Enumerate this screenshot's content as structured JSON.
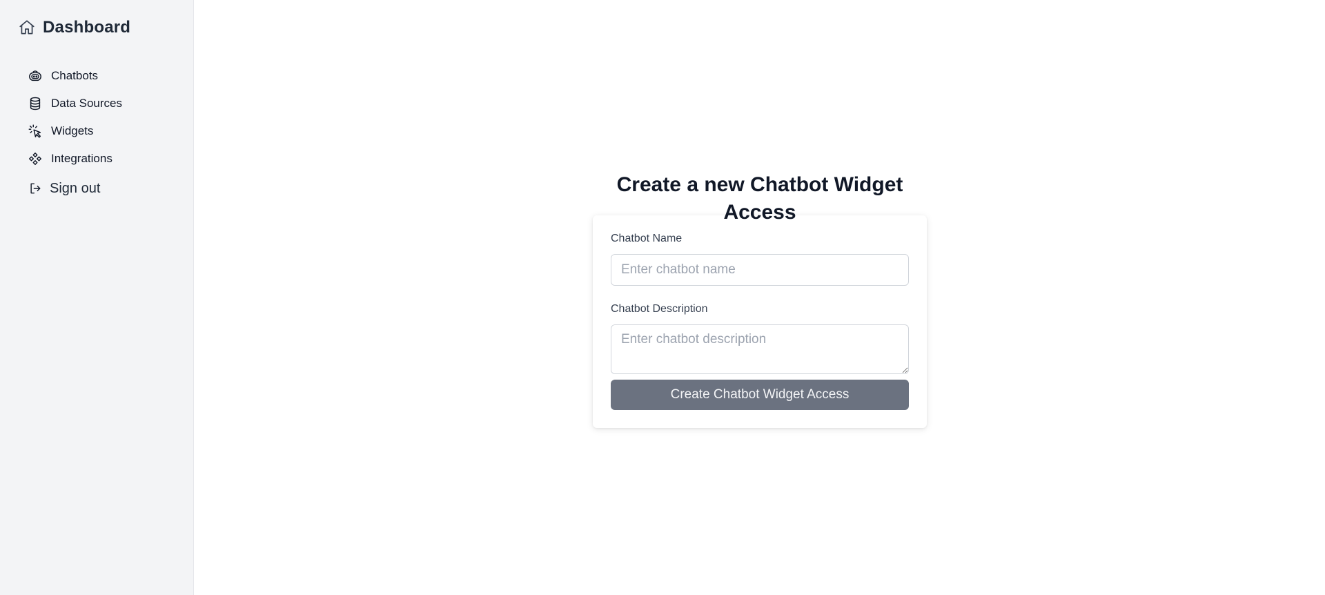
{
  "sidebar": {
    "brand": {
      "label": "Dashboard",
      "icon": "home-icon"
    },
    "items": [
      {
        "label": "Chatbots",
        "icon": "robot-icon"
      },
      {
        "label": "Data Sources",
        "icon": "database-icon"
      },
      {
        "label": "Widgets",
        "icon": "cursor-click-icon"
      },
      {
        "label": "Integrations",
        "icon": "integrations-icon"
      }
    ],
    "signout": {
      "label": "Sign out",
      "icon": "sign-out-icon"
    }
  },
  "main": {
    "title": "Create a new Chatbot Widget Access",
    "form": {
      "name_label": "Chatbot Name",
      "name_value": "",
      "name_placeholder": "Enter chatbot name",
      "description_label": "Chatbot Description",
      "description_value": "",
      "description_placeholder": "Enter chatbot description",
      "submit_label": "Create Chatbot Widget Access"
    }
  },
  "colors": {
    "sidebar_bg": "#f3f4f6",
    "button_bg": "#6b7280",
    "text": "#111827",
    "border": "#d1d5db"
  }
}
